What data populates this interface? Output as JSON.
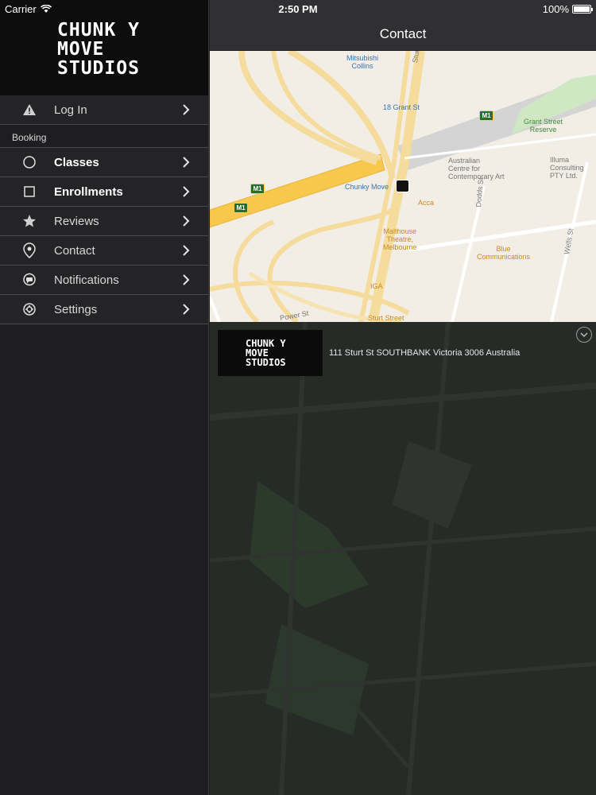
{
  "status_bar": {
    "carrier": "Carrier",
    "time": "2:50 PM",
    "battery": "100%"
  },
  "sidebar": {
    "logo_text": "CHUNK Y\nMOVE\nSTUDIOS",
    "login": {
      "label": "Log In",
      "icon": "warning-icon"
    },
    "section_header": "Booking",
    "items": [
      {
        "label": "Classes",
        "icon": "circle-icon"
      },
      {
        "label": "Enrollments",
        "icon": "square-icon"
      },
      {
        "label": "Reviews",
        "icon": "star-icon"
      },
      {
        "label": "Contact",
        "icon": "location-pin-icon"
      },
      {
        "label": "Notifications",
        "icon": "chat-bubble-icon"
      },
      {
        "label": "Settings",
        "icon": "gear-icon"
      }
    ]
  },
  "main": {
    "title": "Contact",
    "map_labels": {
      "mitsubishi": "Mitsubishi\nCollins",
      "grant_st": "18 Grant St",
      "sturt_st": "Sturt St",
      "grant_reserve": "Grant Street\nReserve",
      "acca_centre": "Australian\nCentre for\nContemporary Art",
      "illuma": "Illuma\nConsulting\nPTY Ltd.",
      "chunky_move": "Chunky Move",
      "acca": "Acca",
      "dodds_st": "Dodds St",
      "wells_st": "Wells St",
      "malthouse": "Malthouse\nTheatre,\nMelbourne",
      "blue_comm": "Blue\nCommunications",
      "iga": "IGA",
      "power_st": "Power St",
      "sturt_street": "Sturt Street",
      "m1": "M1"
    },
    "logo_text": "CHUNK Y\nMOVE\nSTUDIOS",
    "address": "111 Sturt St SOUTHBANK Victoria 3006 Australia"
  }
}
